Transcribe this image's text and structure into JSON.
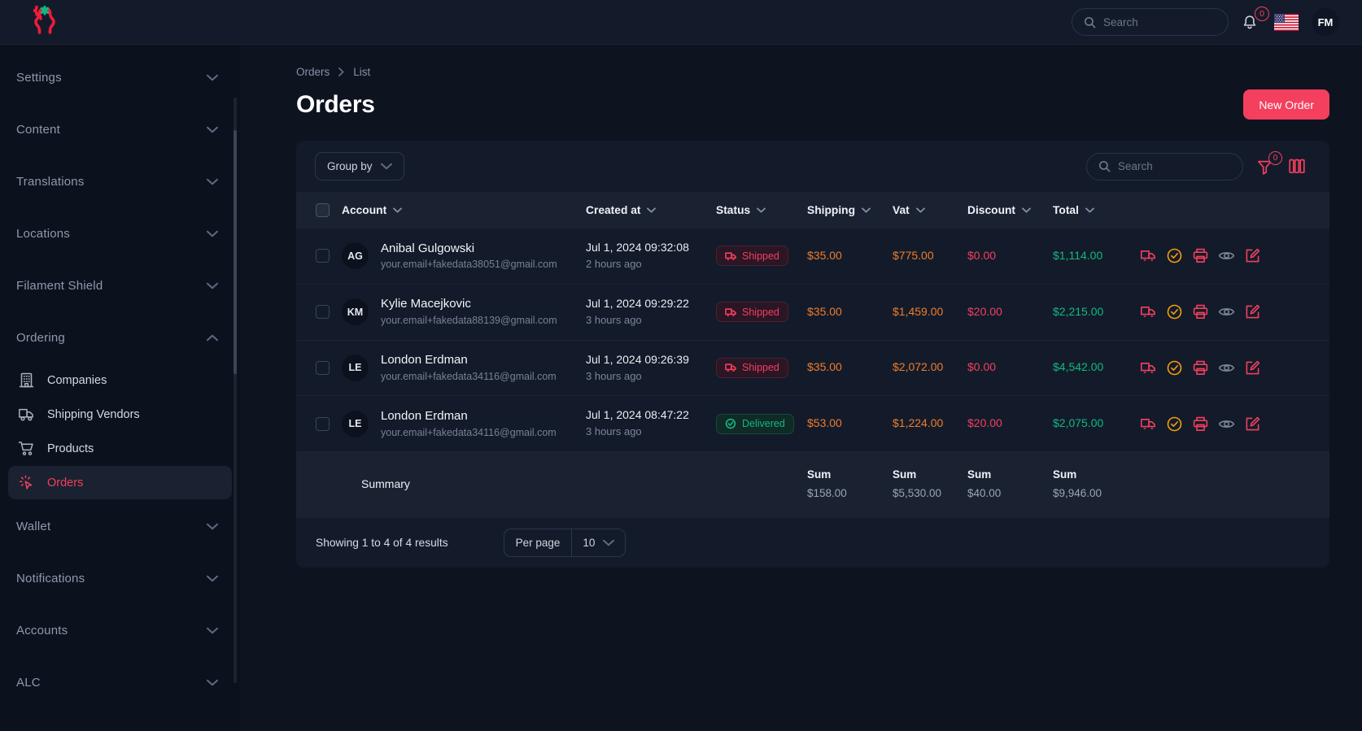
{
  "brand": {
    "logo_name": "curly-brace-asterisk-logo",
    "brace_color": "#f01b3a",
    "asterisk_color": "#12b886"
  },
  "topbar": {
    "search_placeholder": "Search",
    "notification_count": "0",
    "language_flag": "us-flag",
    "avatar_initials": "FM"
  },
  "sidebar": {
    "groups": [
      {
        "label": "Settings",
        "expanded": false
      },
      {
        "label": "Content",
        "expanded": false
      },
      {
        "label": "Translations",
        "expanded": false
      },
      {
        "label": "Locations",
        "expanded": false
      },
      {
        "label": "Filament Shield",
        "expanded": false
      },
      {
        "label": "Ordering",
        "expanded": true
      },
      {
        "label": "Wallet",
        "expanded": false
      },
      {
        "label": "Notifications",
        "expanded": false
      },
      {
        "label": "Accounts",
        "expanded": false
      },
      {
        "label": "ALC",
        "expanded": false
      }
    ],
    "ordering_items": [
      {
        "label": "Companies",
        "icon": "building-icon",
        "active": false
      },
      {
        "label": "Shipping Vendors",
        "icon": "truck-icon",
        "active": false
      },
      {
        "label": "Products",
        "icon": "shopping-cart-icon",
        "active": false
      },
      {
        "label": "Orders",
        "icon": "cursor-click-icon",
        "active": true
      }
    ]
  },
  "breadcrumb": {
    "items": [
      "Orders",
      "List"
    ]
  },
  "page": {
    "title": "Orders",
    "new_order_label": "New Order"
  },
  "toolbar": {
    "group_by_label": "Group by",
    "search_placeholder": "Search",
    "filter_badge": "0",
    "filter_icon": "funnel-icon",
    "columns_icon": "columns-icon"
  },
  "table": {
    "columns": [
      "Account",
      "Created at",
      "Status",
      "Shipping",
      "Vat",
      "Discount",
      "Total"
    ],
    "rows": [
      {
        "initials": "AG",
        "name": "Anibal Gulgowski",
        "email": "your.email+fakedata38051@gmail.com",
        "created_at": "Jul 1, 2024 09:32:08",
        "created_rel": "2 hours ago",
        "status": "Shipped",
        "status_kind": "shipped",
        "shipping": "$35.00",
        "vat": "$775.00",
        "discount": "$0.00",
        "total": "$1,114.00"
      },
      {
        "initials": "KM",
        "name": "Kylie Macejkovic",
        "email": "your.email+fakedata88139@gmail.com",
        "created_at": "Jul 1, 2024 09:29:22",
        "created_rel": "3 hours ago",
        "status": "Shipped",
        "status_kind": "shipped",
        "shipping": "$35.00",
        "vat": "$1,459.00",
        "discount": "$20.00",
        "total": "$2,215.00"
      },
      {
        "initials": "LE",
        "name": "London Erdman",
        "email": "your.email+fakedata34116@gmail.com",
        "created_at": "Jul 1, 2024 09:26:39",
        "created_rel": "3 hours ago",
        "status": "Shipped",
        "status_kind": "shipped",
        "shipping": "$35.00",
        "vat": "$2,072.00",
        "discount": "$0.00",
        "total": "$4,542.00"
      },
      {
        "initials": "LE",
        "name": "London Erdman",
        "email": "your.email+fakedata34116@gmail.com",
        "created_at": "Jul 1, 2024 08:47:22",
        "created_rel": "3 hours ago",
        "status": "Delivered",
        "status_kind": "delivered",
        "shipping": "$53.00",
        "vat": "$1,224.00",
        "discount": "$20.00",
        "total": "$2,075.00"
      }
    ],
    "row_actions": [
      "truck-icon",
      "check-circle-icon",
      "printer-icon",
      "eye-icon",
      "edit-square-icon"
    ],
    "summary": {
      "label": "Summary",
      "shipping_head": "Sum",
      "shipping_value": "$158.00",
      "vat_head": "Sum",
      "vat_value": "$5,530.00",
      "discount_head": "Sum",
      "discount_value": "$40.00",
      "total_head": "Sum",
      "total_value": "$9,946.00"
    }
  },
  "footer": {
    "showing": "Showing 1 to 4 of 4 results",
    "per_page_label": "Per page",
    "per_page_value": "10"
  },
  "colors": {
    "accent": "#f43f5e",
    "orange": "#f07c2c",
    "green": "#10b981",
    "page_bg": "#0d1420",
    "card_bg": "#131b2a"
  }
}
